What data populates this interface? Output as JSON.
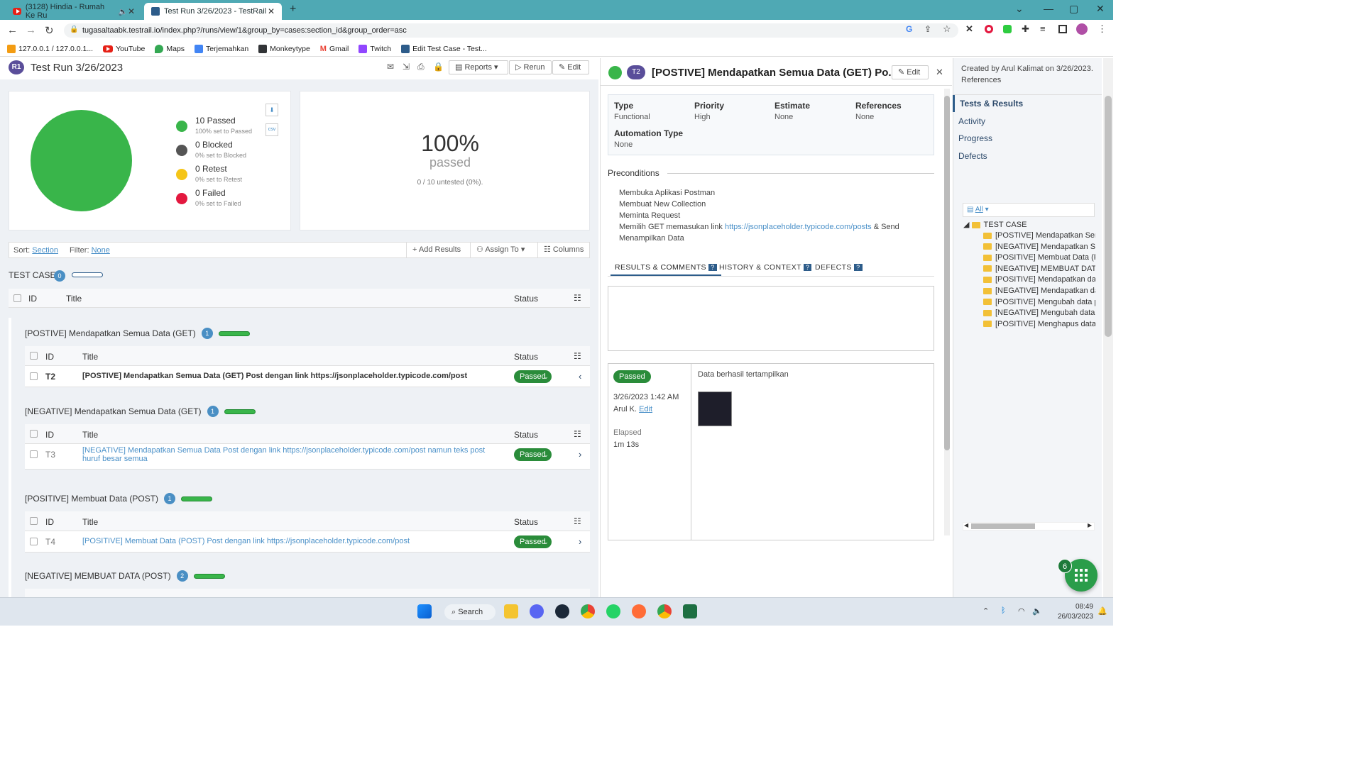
{
  "browser": {
    "tabs": [
      {
        "label": "(3128) Hindia - Rumah Ke Ru"
      },
      {
        "label": "Test Run 3/26/2023 - TestRail"
      }
    ],
    "url": "tugasaltaabk.testrail.io/index.php?/runs/view/1&group_by=cases:section_id&group_order=asc",
    "bookmarks": [
      "127.0.0.1 / 127.0.0.1...",
      "YouTube",
      "Maps",
      "Terjemahkan",
      "Monkeytype",
      "Gmail",
      "Twitch",
      "Edit Test Case - Test..."
    ]
  },
  "header": {
    "avatar": "R1",
    "title": "Test Run 3/26/2023",
    "reports": "Reports",
    "rerun": "Rerun",
    "edit": "Edit"
  },
  "summary": {
    "legend": [
      {
        "label": "10 Passed",
        "sub": "100% set to Passed",
        "color": "#39b54a"
      },
      {
        "label": "0 Blocked",
        "sub": "0% set to Blocked",
        "color": "#555555"
      },
      {
        "label": "0 Retest",
        "sub": "0% set to Retest",
        "color": "#f5c518"
      },
      {
        "label": "0 Failed",
        "sub": "0% set to Failed",
        "color": "#e3183f"
      }
    ],
    "percent": "100%",
    "percent_label": "passed",
    "untested": "0 / 10 untested (0%).",
    "pie_passed_fraction": 1.0
  },
  "filterbar": {
    "sort_label": "Sort:",
    "sort_value": "Section",
    "filter_label": "Filter:",
    "filter_value": "None",
    "add_results": "Add Results",
    "assign_to": "Assign To",
    "columns": "Columns"
  },
  "group": {
    "title": "TEST CASE",
    "count": "0"
  },
  "table_headers": {
    "id": "ID",
    "title": "Title",
    "status": "Status"
  },
  "sections": [
    {
      "title": "[POSTIVE] Mendapatkan Semua Data (GET)",
      "count": "1",
      "rows": [
        {
          "id": "T2",
          "title": "[POSTIVE] Mendapatkan Semua Data (GET) Post dengan link https://jsonplaceholder.typicode.com/post",
          "status": "Passed"
        }
      ]
    },
    {
      "title": "[NEGATIVE] Mendapatkan Semua Data (GET)",
      "count": "1",
      "rows": [
        {
          "id": "T3",
          "title": "[NEGATIVE] Mendapatkan Semua Data Post dengan link https://jsonplaceholder.typicode.com/post namun teks post huruf besar semua",
          "status": "Passed"
        }
      ]
    },
    {
      "title": "[POSITIVE] Membuat Data (POST)",
      "count": "1",
      "rows": [
        {
          "id": "T4",
          "title": "[POSITIVE] Membuat Data (POST) Post dengan link https://jsonplaceholder.typicode.com/post",
          "status": "Passed"
        }
      ]
    },
    {
      "title": "[NEGATIVE] MEMBUAT DATA (POST)",
      "count": "2",
      "rows": []
    }
  ],
  "detail": {
    "id": "T2",
    "title": "[POSTIVE] Mendapatkan Semua Data (GET) Po...",
    "edit": "Edit",
    "fields": [
      {
        "label": "Type",
        "value": "Functional"
      },
      {
        "label": "Priority",
        "value": "High"
      },
      {
        "label": "Estimate",
        "value": "None"
      },
      {
        "label": "References",
        "value": "None"
      },
      {
        "label": "Automation Type",
        "value": "None"
      }
    ],
    "preconditions_title": "Preconditions",
    "preconditions": [
      "Membuka Aplikasi Postman",
      "Membuat New Collection",
      "Meminta Request"
    ],
    "pre4_text": "Memilih GET memasukan link ",
    "pre4_link": "https://jsonplaceholder.typicode.com/posts",
    "pre4_tail": " & Send",
    "pre5": "Menampilkan Data",
    "tabs": [
      "RESULTS & COMMENTS",
      "HISTORY & CONTEXT",
      "DEFECTS"
    ],
    "tab_help": "?",
    "result": {
      "status": "Passed",
      "date": "3/26/2023 1:42 AM",
      "user": "Arul K.",
      "edit": "Edit",
      "elapsed_label": "Elapsed",
      "elapsed": "1m 13s",
      "comment": "Data berhasil tertampilkan"
    }
  },
  "sidebar": {
    "created": "Created by Arul Kalimat on 3/26/2023.",
    "references": "References",
    "nav": [
      "Tests & Results",
      "Activity",
      "Progress",
      "Defects"
    ],
    "filter": "All",
    "tree_root": "TEST CASE",
    "tree": [
      "[POSTIVE] Mendapatkan Ser",
      "[NEGATIVE] Mendapatkan Se",
      "[POSITIVE] Membuat Data (F",
      "[NEGATIVE] MEMBUAT DATA",
      "[POSITIVE] Mendapatkan da",
      "[NEGATIVE] Mendapatkan da",
      "[POSITIVE] Mengubah data p",
      "[NEGATIVE] Mengubah data",
      "[POSITIVE] Menghapus data"
    ],
    "fab_badge": "6"
  },
  "taskbar": {
    "search": "Search",
    "time": "08:49",
    "date": "26/03/2023"
  }
}
